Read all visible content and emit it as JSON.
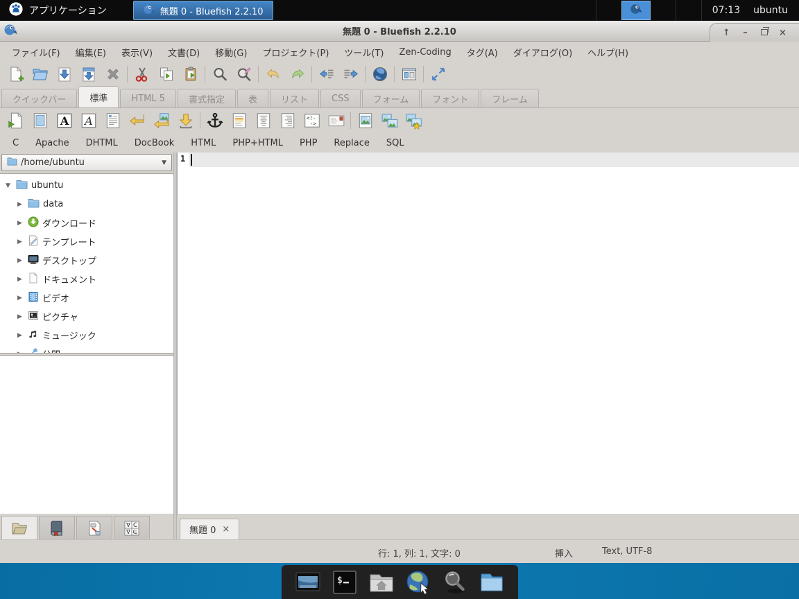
{
  "taskbar": {
    "applications_label": "アプリケーション",
    "window_button_label": "無題 0 - Bluefish 2.2.10",
    "clock": "07:13",
    "user": "ubuntu"
  },
  "titlebar": {
    "title": "無題 0 - Bluefish 2.2.10",
    "controls": {
      "shade": "↑",
      "minimize": "–",
      "close": "×"
    }
  },
  "menubar": {
    "items": [
      "ファイル(F)",
      "編集(E)",
      "表示(V)",
      "文書(D)",
      "移動(G)",
      "プロジェクト(P)",
      "ツール(T)",
      "Zen-Coding",
      "タグ(A)",
      "ダイアログ(O)",
      "ヘルプ(H)"
    ]
  },
  "main_toolbar": {
    "icons": [
      "new-document",
      "open",
      "save",
      "save-as",
      "close",
      "cut",
      "copy",
      "paste",
      "find",
      "find-replace",
      "undo",
      "redo",
      "unindent",
      "indent",
      "view-in-browser",
      "toggle-panel",
      "fullscreen"
    ]
  },
  "quickbar": {
    "tabs": [
      "クイックバー",
      "標準",
      "HTML 5",
      "書式指定",
      "表",
      "リスト",
      "CSS",
      "フォーム",
      "フォント",
      "フレーム"
    ],
    "active_tab": "標準"
  },
  "html_toolbar": {
    "icons": [
      "quickstart",
      "body",
      "bold",
      "italic",
      "paragraph",
      "break",
      "break-and-clear",
      "non-breaking-space",
      "anchor",
      "rule",
      "center",
      "right-justify",
      "comment",
      "email",
      "insert-image",
      "thumbnail",
      "multi-thumbnail"
    ]
  },
  "language_bar": {
    "items": [
      "C",
      "Apache",
      "DHTML",
      "DocBook",
      "HTML",
      "PHP+HTML",
      "PHP",
      "Replace",
      "SQL"
    ]
  },
  "sidebar": {
    "path_combo_value": "/home/ubuntu",
    "tree": [
      {
        "label": "ubuntu",
        "icon": "folder",
        "expanded": true
      },
      {
        "label": "data",
        "icon": "folder",
        "expanded": false
      },
      {
        "label": "ダウンロード",
        "icon": "downloads-folder",
        "expanded": false
      },
      {
        "label": "テンプレート",
        "icon": "templates-folder",
        "expanded": false
      },
      {
        "label": "デスクトップ",
        "icon": "desktop-folder",
        "expanded": false
      },
      {
        "label": "ドキュメント",
        "icon": "documents-folder",
        "expanded": false
      },
      {
        "label": "ビデオ",
        "icon": "videos-folder",
        "expanded": false
      },
      {
        "label": "ピクチャ",
        "icon": "pictures-folder",
        "expanded": false
      },
      {
        "label": "ミュージック",
        "icon": "music-folder",
        "expanded": false
      },
      {
        "label": "公開",
        "icon": "public-folder",
        "expanded": false
      }
    ],
    "bottom_tabs": [
      "file-browser",
      "bookmarks",
      "snippets",
      "character-map"
    ]
  },
  "editor": {
    "line_number": "1",
    "doc_tab": {
      "label": "無題 0",
      "close": "×"
    }
  },
  "statusbar": {
    "cursor_position": "行: 1, 列: 1, 文字: 0",
    "insert_mode": "挿入",
    "doc_type": "Text, UTF-8"
  },
  "dock": {
    "icons": [
      "show-desktop",
      "terminal",
      "home-folder",
      "web-browser",
      "search",
      "file-manager"
    ]
  },
  "icons_glyphs": {
    "expander_open": "▼",
    "expander_closed": "▶",
    "dropdown_arrow": "▼"
  },
  "colors": {
    "desktop_blue": "#0b72a8",
    "taskbar_black": "#0c0c0c",
    "window_chrome": "#d6d2ce",
    "active_task_blue": "#3a7cc0",
    "tray_highlight_blue": "#4a90d9"
  }
}
